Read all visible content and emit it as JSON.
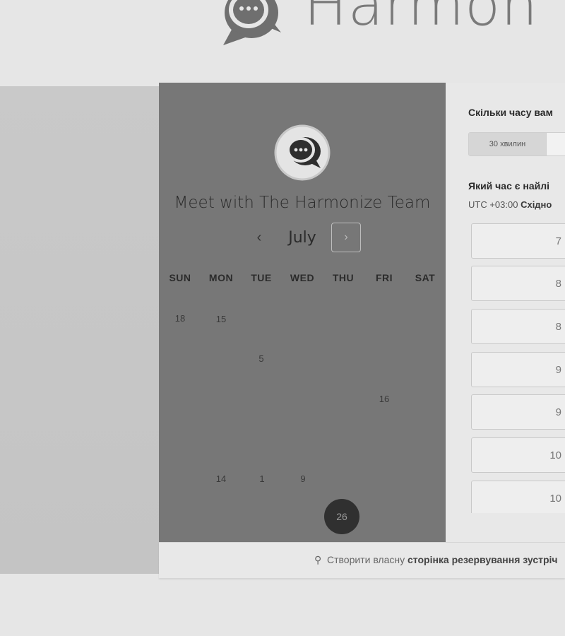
{
  "header": {
    "brand": "Harmon"
  },
  "profile": {
    "title": "Meet with The Harmonize Team"
  },
  "calendar": {
    "month": "July",
    "prev_label": "‹",
    "next_label": "›",
    "weekdays": [
      "SUN",
      "MON",
      "TUE",
      "WED",
      "THU",
      "FRI",
      "SAT"
    ],
    "days": [
      "18",
      "15",
      "5",
      "16",
      "14",
      "1",
      "9"
    ],
    "selected_day": "26"
  },
  "duration": {
    "question": "Скільки часу вам",
    "options": [
      "30 хвилин"
    ]
  },
  "time": {
    "question": "Який час є найлі",
    "timezone_offset": "UTC +03:00",
    "timezone_name": "Східно"
  },
  "slots": [
    "7",
    "8",
    "8",
    "9",
    "9",
    "10",
    "10"
  ],
  "footer": {
    "prefix": "Створити власну",
    "link": "сторінка резервування зустріч"
  },
  "colors": {
    "left_pane": "#777777",
    "right_pane": "#e8e8e8",
    "selected_day": "#303030"
  }
}
